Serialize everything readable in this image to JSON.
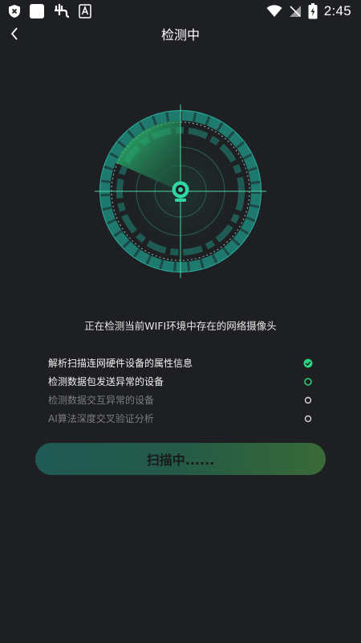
{
  "status_bar": {
    "time": "2:45",
    "icons": [
      "shield-x-icon",
      "white-square-icon",
      "app-glyph-icon",
      "font-a-icon",
      "wifi-icon",
      "no-signal-icon",
      "battery-charging-icon"
    ]
  },
  "header": {
    "title": "检测中",
    "back_icon": "chevron-left-icon"
  },
  "radar": {
    "icon": "camera-icon",
    "colors": {
      "accent": "#2fd07e",
      "teal": "#22a892",
      "grid": "#3a6a5c"
    }
  },
  "description": "正在检测当前WIFI环境中存在的网络摄像头",
  "checks": [
    {
      "label": "解析扫描连网硬件设备的属性信息",
      "state": "done"
    },
    {
      "label": "检测数据包发送异常的设备",
      "state": "running"
    },
    {
      "label": "检测数据交互异常的设备",
      "state": "pending"
    },
    {
      "label": "AI算法深度交叉验证分析",
      "state": "pending"
    }
  ],
  "scan_button": {
    "label": "扫描中......"
  }
}
